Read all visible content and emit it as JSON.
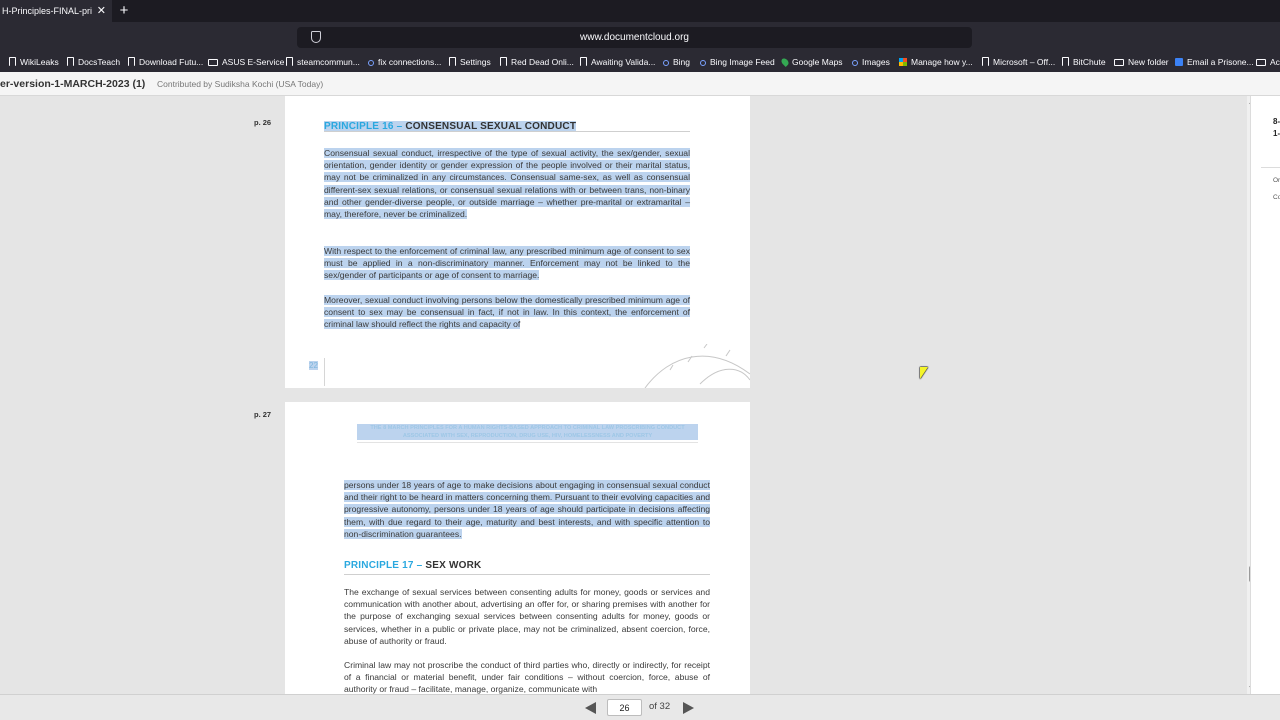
{
  "browser": {
    "tab_title": "H-Principles-FINAL-prin",
    "tab_close": "✕",
    "new_tab": "+",
    "url": "www.documentcloud.org",
    "bookmarks": [
      {
        "label": "WikiLeaks",
        "icon": "bookmark-icon"
      },
      {
        "label": "DocsTeach",
        "icon": "bookmark-icon"
      },
      {
        "label": "Download Futu...",
        "icon": "bookmark-icon"
      },
      {
        "label": "ASUS E-Service",
        "icon": "folder-icon"
      },
      {
        "label": "steamcommun...",
        "icon": "bookmark-icon"
      },
      {
        "label": "fix connections...",
        "icon": "search-icon"
      },
      {
        "label": "Settings",
        "icon": "bookmark-icon"
      },
      {
        "label": "Red Dead Onli...",
        "icon": "bookmark-icon"
      },
      {
        "label": "Awaiting Valida...",
        "icon": "bookmark-icon"
      },
      {
        "label": "Bing",
        "icon": "search-icon"
      },
      {
        "label": "Bing Image Feed",
        "icon": "search-icon"
      },
      {
        "label": "Google Maps",
        "icon": "map-pin-icon"
      },
      {
        "label": "Images",
        "icon": "search-icon"
      },
      {
        "label": "Manage how y...",
        "icon": "microsoft-icon"
      },
      {
        "label": "Microsoft – Off...",
        "icon": "bookmark-icon"
      },
      {
        "label": "BitChute",
        "icon": "bookmark-icon"
      },
      {
        "label": "New folder",
        "icon": "folder-icon"
      },
      {
        "label": "Email a Prisone...",
        "icon": "mail-icon"
      },
      {
        "label": "Ac",
        "icon": "folder-icon"
      }
    ]
  },
  "document": {
    "title": "er-version-1-MARCH-2023 (1)",
    "contributor": "Contributed by Sudiksha Kochi (USA Today)"
  },
  "pages": {
    "p26": {
      "label": "p. 26",
      "heading_num": "PRINCIPLE 16",
      "heading_dash": " – ",
      "heading_name": "CONSENSUAL SEXUAL CONDUCT",
      "para1": "Consensual sexual conduct, irrespective of the type of sexual activity, the sex/gender, sexual orientation, gender identity or gender expression of the people involved or their marital status, may not be criminalized in any circumstances. Consensual same-sex, as well as consensual different-sex sexual relations, or consensual sexual relations with or between trans, non-binary and other gender-diverse people, or outside marriage – whether pre-marital or extramarital – may, therefore, never be criminalized.",
      "para2": "With respect to the enforcement of criminal law, any prescribed minimum age of consent to sex must be applied in a non-discriminatory manner. Enforcement may not be linked to the sex/gender of participants or age of consent to marriage.",
      "para3": "Moreover, sexual conduct involving persons below the domestically prescribed minimum age of consent to sex may be consensual in fact, if not in law. In this context, the enforcement of criminal law should reflect the rights and capacity of",
      "folio": "22"
    },
    "p27": {
      "label": "p. 27",
      "running_head": "THE 8 MARCH PRINCIPLES FOR A HUMAN RIGHTS-BASED APPROACH TO CRIMINAL LAW PROSCRIBING CONDUCT ASSOCIATED WITH SEX, REPRODUCTION, DRUG USE, HIV, HOMELESSNESS AND POVERTY",
      "para1": "persons under 18 years of age to make decisions about engaging in consensual sexual conduct and their right to be heard in matters concerning them. Pursuant to their evolving capacities and progressive autonomy, persons under 18 years of age should participate in decisions affecting them, with due regard to their age, maturity and best interests, and with specific attention to non-discrimination guarantees.",
      "heading_num": "PRINCIPLE 17",
      "heading_dash": " – ",
      "heading_name": "SEX WORK",
      "para2": "The exchange of sexual services between consenting adults for money, goods or services and communication with another about, advertising an offer for, or sharing premises with another for the purpose of exchanging sexual services between consenting adults for money, goods or services, whether in a public or private place, may not be criminalized, absent coercion, force, abuse of authority or fraud.",
      "para3": "Criminal law may not proscribe the conduct of third parties who, directly or indirectly, for receipt of a financial or material benefit, under fair conditions – without coercion, force, abuse of authority or fraud – facilitate, manage, organize, communicate with"
    }
  },
  "sidebar": {
    "line1": "8-",
    "line2": "1-",
    "line3": "Or",
    "line4": "Co"
  },
  "pager": {
    "current_page": "26",
    "total": "of 32"
  },
  "colors": {
    "accent": "#2aa8df",
    "highlight": "#bcd3ee"
  }
}
